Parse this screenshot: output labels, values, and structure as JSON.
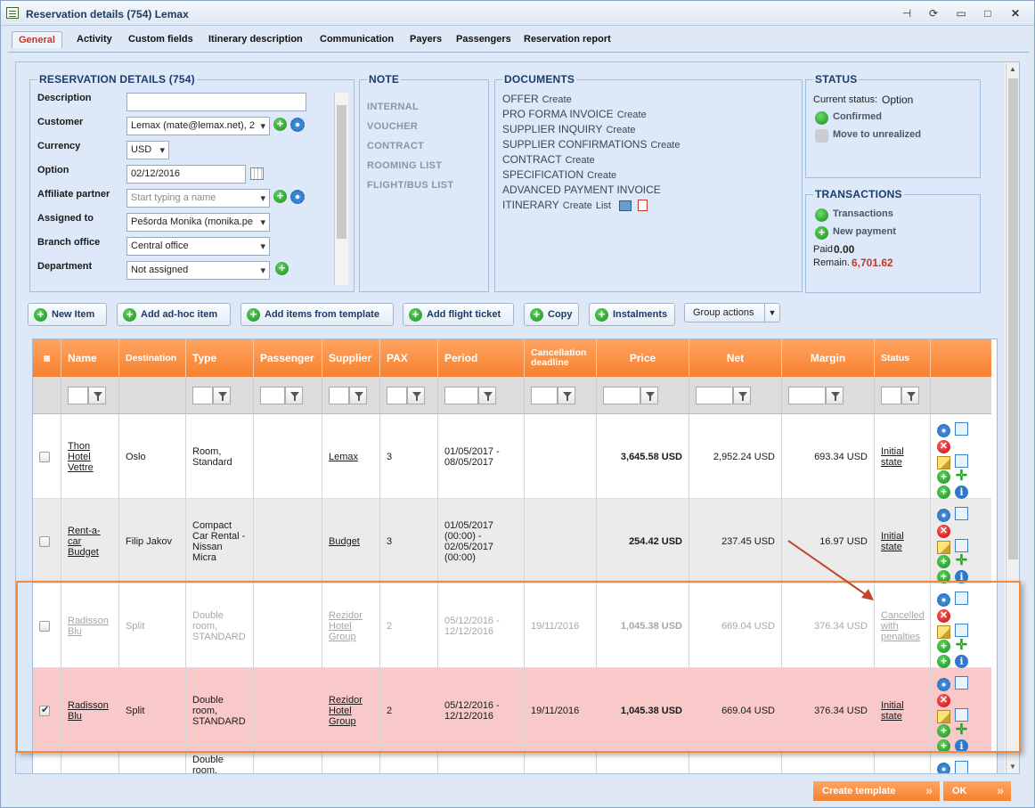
{
  "window": {
    "title": "Reservation details (754) Lemax",
    "pin": "⊣",
    "refresh": "⟳",
    "restore": "▭",
    "maximize": "□",
    "close": "✕"
  },
  "tabs": [
    "General",
    "Activity",
    "Custom fields",
    "Itinerary description",
    "Communication",
    "Payers",
    "Passengers",
    "Reservation report"
  ],
  "details": {
    "legend": "RESERVATION DETAILS (754)",
    "labels": {
      "description": "Description",
      "customer": "Customer",
      "currency": "Currency",
      "option": "Option",
      "affiliate": "Affiliate partner",
      "assigned": "Assigned to",
      "branch": "Branch office",
      "department": "Department"
    },
    "values": {
      "description": "",
      "customer": "Lemax (mate@lemax.net), 2",
      "currency": "USD",
      "option": "02/12/2016",
      "affiliate": "Start typing a name",
      "assigned": "Pešorda Monika (monika.pe",
      "branch": "Central office",
      "department": "Not assigned"
    }
  },
  "note": {
    "legend": "NOTE",
    "items": [
      "INTERNAL",
      "VOUCHER",
      "CONTRACT",
      "ROOMING LIST",
      "FLIGHT/BUS LIST"
    ]
  },
  "documents": {
    "legend": "DOCUMENTS",
    "items": [
      {
        "name": "OFFER",
        "links": [
          "Create"
        ]
      },
      {
        "name": "PRO FORMA INVOICE",
        "links": [
          "Create"
        ]
      },
      {
        "name": "SUPPLIER INQUIRY",
        "links": [
          "Create"
        ]
      },
      {
        "name": "SUPPLIER CONFIRMATIONS",
        "links": [
          "Create"
        ]
      },
      {
        "name": "CONTRACT",
        "links": [
          "Create"
        ]
      },
      {
        "name": "SPECIFICATION",
        "links": [
          "Create"
        ]
      },
      {
        "name": "ADVANCED PAYMENT INVOICE",
        "links": []
      },
      {
        "name": "ITINERARY",
        "links": [
          "Create",
          "List"
        ]
      }
    ]
  },
  "status": {
    "legend": "STATUS",
    "current_label": "Current status:",
    "current_value": "Option",
    "confirmed": "Confirmed",
    "move": "Move to unrealized"
  },
  "transactions": {
    "legend": "TRANSACTIONS",
    "transactions": "Transactions",
    "new_payment": "New payment",
    "paid_label": "Paid",
    "paid_value": "0.00",
    "remain_label": "Remain.",
    "remain_value": "6,701.62",
    "remain_color": "#c0392b"
  },
  "actions": {
    "new_item": "New Item",
    "add_adhoc": "Add ad-hoc item",
    "add_template": "Add items from template",
    "add_flight": "Add flight ticket",
    "copy": "Copy",
    "instalments": "Instalments",
    "group_actions": "Group actions"
  },
  "grid": {
    "headers": [
      "",
      "Name",
      "Destination",
      "Type",
      "Passenger",
      "Supplier",
      "PAX",
      "Period",
      "Cancellation deadline",
      "Price",
      "Net",
      "Margin",
      "Status",
      ""
    ],
    "rows": [
      {
        "checked": false,
        "name": "Thon Hotel Vettre",
        "destination": "Oslo",
        "type": "Room, Standard",
        "passenger": "",
        "supplier": "Lemax",
        "pax": "3",
        "period": "01/05/2017 - 08/05/2017",
        "cancel": "",
        "price": "3,645.58 USD",
        "net": "2,952.24 USD",
        "margin": "693.34 USD",
        "status": "Initial state"
      },
      {
        "checked": false,
        "name": "Rent-a-car Budget",
        "destination": "Filip Jakov",
        "type": "Compact Car Rental - Nissan Micra",
        "passenger": "",
        "supplier": "Budget",
        "pax": "3",
        "period": "01/05/2017 (00:00) - 02/05/2017 (00:00)",
        "cancel": "",
        "price": "254.42 USD",
        "net": "237.45 USD",
        "margin": "16.97 USD",
        "status": "Initial state"
      },
      {
        "checked": false,
        "name": "Radisson Blu",
        "destination": "Split",
        "type": "Double room, STANDARD",
        "passenger": "",
        "supplier": "Rezidor Hotel Group",
        "pax": "2",
        "period": "05/12/2016 - 12/12/2016",
        "cancel": "19/11/2016",
        "price": "1,045.38 USD",
        "net": "669.04 USD",
        "margin": "376.34 USD",
        "status": "Cancelled with penalties"
      },
      {
        "checked": true,
        "name": "Radisson Blu",
        "destination": "Split",
        "type": "Double room, STANDARD",
        "passenger": "",
        "supplier": "Rezidor Hotel Group",
        "pax": "2",
        "period": "05/12/2016 - 12/12/2016",
        "cancel": "19/11/2016",
        "price": "1,045.38 USD",
        "net": "669.04 USD",
        "margin": "376.34 USD",
        "status": "Initial state"
      },
      {
        "checked": false,
        "name": "",
        "destination": "",
        "type": "Double room,",
        "passenger": "",
        "supplier": "",
        "pax": "",
        "period": "",
        "cancel": "",
        "price": "",
        "net": "",
        "margin": "",
        "status": ""
      }
    ]
  },
  "footer": {
    "create_template": "Create template",
    "ok": "OK"
  },
  "colors": {
    "accent": "#f7812f",
    "row_alt": "#ebebeb",
    "row_selected": "#f9c8c8"
  }
}
